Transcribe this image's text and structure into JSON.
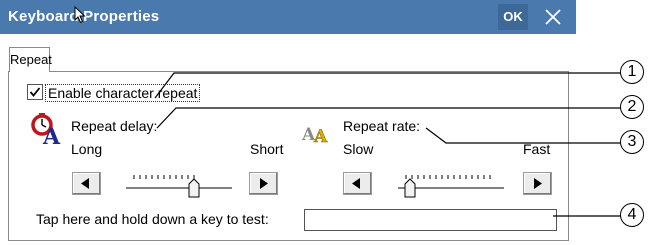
{
  "window": {
    "title": "Keyboard Properties",
    "ok_label": "OK"
  },
  "tabs": [
    {
      "label": "Repeat"
    }
  ],
  "enable_repeat": {
    "label": "Enable character repeat",
    "checked": true
  },
  "repeat_delay": {
    "label": "Repeat delay:",
    "min_label": "Long",
    "max_label": "Short"
  },
  "repeat_rate": {
    "label": "Repeat rate:",
    "min_label": "Slow",
    "max_label": "Fast"
  },
  "test": {
    "label": "Tap here and hold down a key to test:",
    "value": ""
  },
  "callouts": [
    "1",
    "2",
    "3",
    "4"
  ],
  "icons": {
    "delay": "stopwatch-a-icon",
    "rate": "double-a-icon"
  },
  "colors": {
    "titlebar": "#4a79ad",
    "titlebar_text": "#ffffff"
  }
}
